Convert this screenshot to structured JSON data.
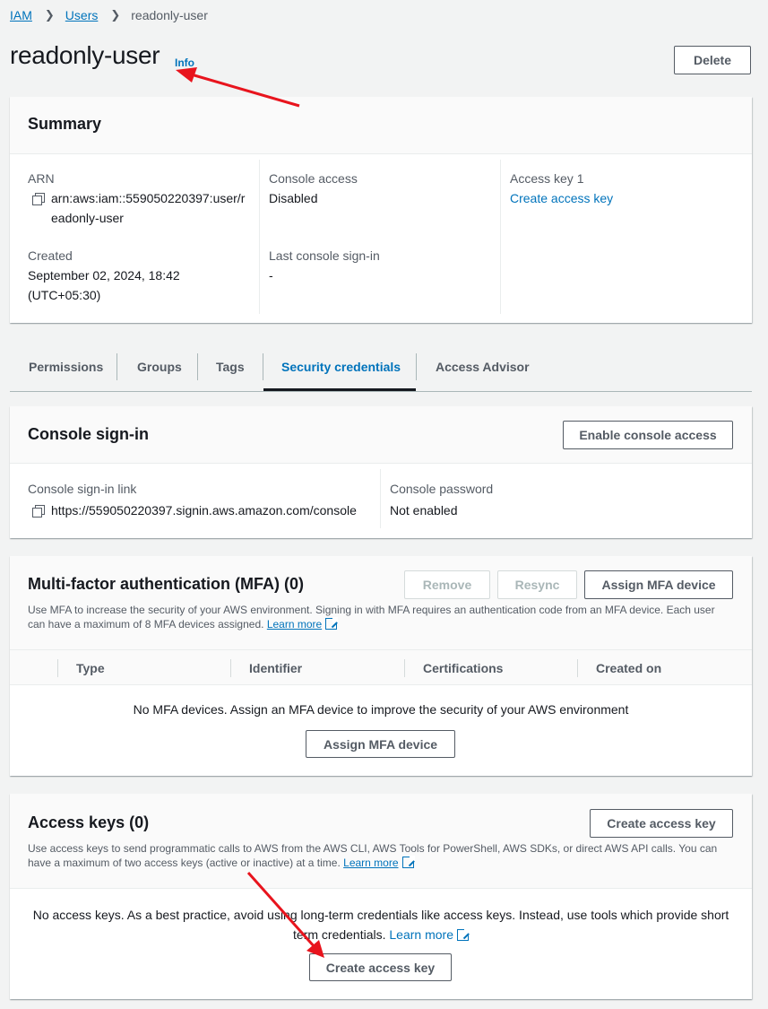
{
  "breadcrumb": {
    "root": "IAM",
    "users": "Users",
    "current": "readonly-user"
  },
  "page": {
    "title": "readonly-user",
    "info": "Info",
    "delete_label": "Delete"
  },
  "summary": {
    "title": "Summary",
    "arn_label": "ARN",
    "arn_line1": "arn:aws:iam::559050220397:user/r",
    "arn_line2": "eadonly-user",
    "created_label": "Created",
    "created_line1": "September 02, 2024, 18:42",
    "created_line2": "(UTC+05:30)",
    "console_access_label": "Console access",
    "console_access_value": "Disabled",
    "last_signin_label": "Last console sign-in",
    "last_signin_value": "-",
    "access_key_label": "Access key 1",
    "access_key_link": "Create access key"
  },
  "tabs": [
    "Permissions",
    "Groups",
    "Tags",
    "Security credentials",
    "Access Advisor"
  ],
  "console_signin": {
    "title": "Console sign-in",
    "enable_label": "Enable console access",
    "link_label": "Console sign-in link",
    "link_value": "https://559050220397.signin.aws.amazon.com/console",
    "password_label": "Console password",
    "password_value": "Not enabled"
  },
  "mfa": {
    "title": "Multi-factor authentication (MFA) (0)",
    "remove_label": "Remove",
    "resync_label": "Resync",
    "assign_label": "Assign MFA device",
    "desc_line1": "Use MFA to increase the security of your AWS environment. Signing in with MFA requires an authentication code from an MFA device. Each user",
    "desc_line2": "can have a maximum of 8 MFA devices assigned.",
    "learn_more": "Learn more",
    "columns": [
      "Type",
      "Identifier",
      "Certifications",
      "Created on"
    ],
    "empty_text": "No MFA devices. Assign an MFA device to improve the security of your AWS environment",
    "empty_button": "Assign MFA device"
  },
  "access_keys": {
    "title": "Access keys (0)",
    "create_label": "Create access key",
    "desc_line1": "Use access keys to send programmatic calls to AWS from the AWS CLI, AWS Tools for PowerShell, AWS SDKs, or direct AWS API calls. You can",
    "desc_line2": "have a maximum of two access keys (active or inactive) at a time.",
    "learn_more": "Learn more",
    "empty_line1": "No access keys. As a best practice, avoid using long-term credentials like access keys. Instead, use tools which provide short",
    "empty_line2": "term credentials.",
    "empty_learn_more": "Learn more",
    "empty_button": "Create access key"
  },
  "colors": {
    "link": "#0073bb",
    "annotation_arrow": "#e8141d",
    "active_tab": "#0073bb"
  }
}
